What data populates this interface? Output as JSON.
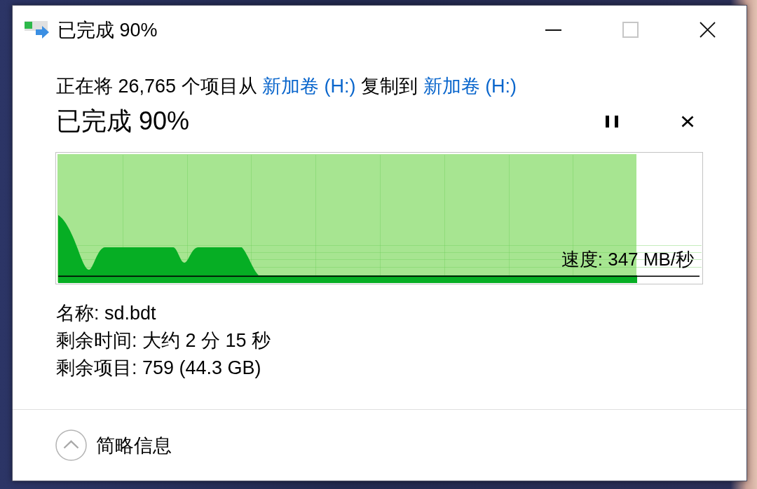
{
  "window": {
    "title": "已完成 90%",
    "controls": [
      {
        "kind": "minimize",
        "disabled": false
      },
      {
        "kind": "maximize",
        "disabled": true
      },
      {
        "kind": "close",
        "disabled": false
      }
    ]
  },
  "copy_summary": [
    {
      "kind": "text",
      "text": "正在将 26,765 个项目从"
    },
    {
      "kind": "link",
      "text": "新加卷 (H:)"
    },
    {
      "kind": "text",
      "text": "复制到"
    },
    {
      "kind": "link",
      "text": "新加卷 (H:)"
    }
  ],
  "progress": {
    "heading": "已完成 90%",
    "actions": [
      {
        "kind": "pause"
      },
      {
        "kind": "cancel"
      }
    ],
    "level": 0.9,
    "speed": "速度: 347 MB/秒"
  },
  "details": [
    "名称: sd.bdt",
    "剩余时间: 大约 2 分 15 秒",
    "剩余项目: 759 (44.3 GB)"
  ],
  "footer": {
    "toggle": {
      "label": "简略信息",
      "expanded": true
    }
  }
}
